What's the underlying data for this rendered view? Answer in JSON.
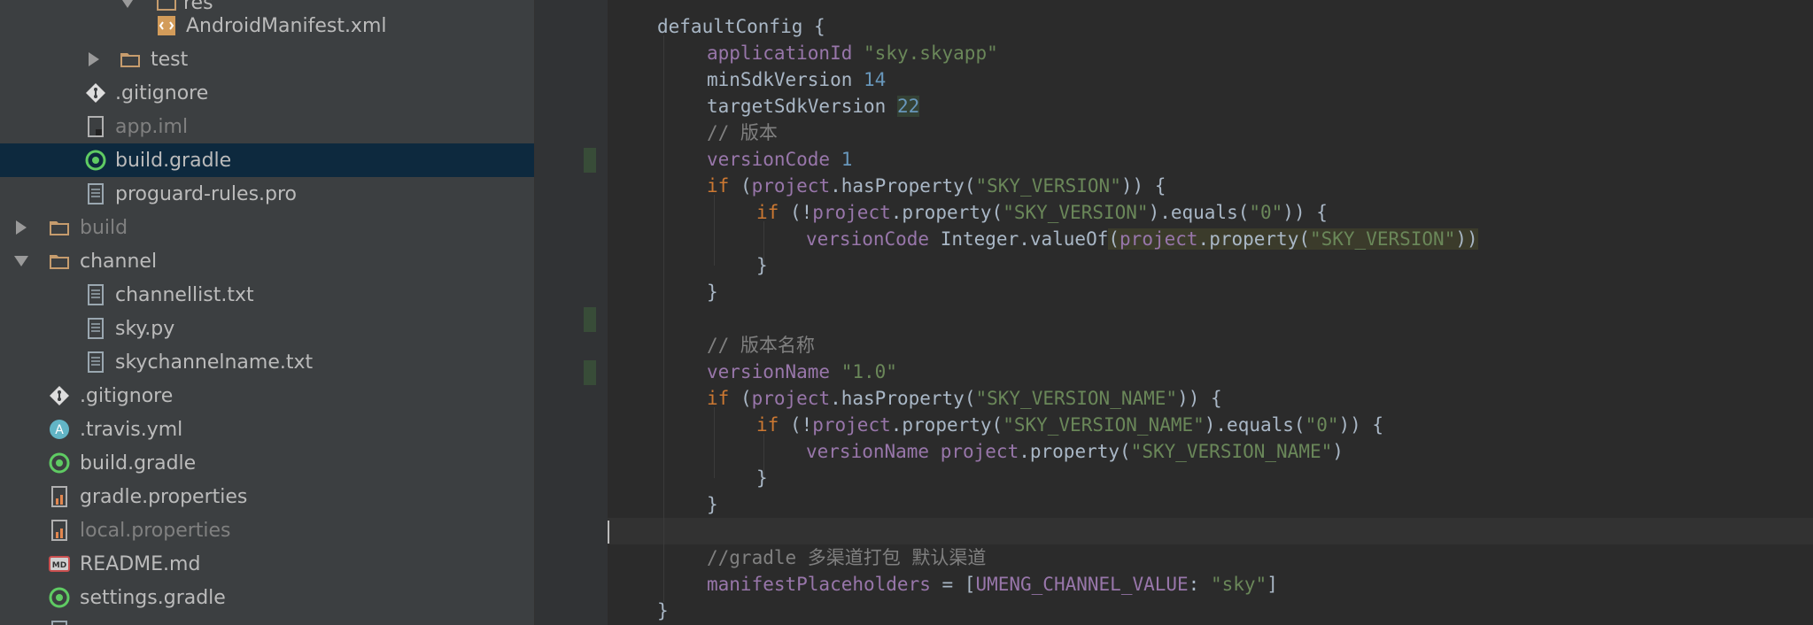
{
  "project_tree": {
    "items": [
      {
        "label": "res",
        "icon": "folder-icon",
        "arrow": "down"
      },
      {
        "label": "AndroidManifest.xml",
        "icon": "xml-file-icon"
      },
      {
        "label": "test",
        "icon": "folder-icon",
        "arrow": "right"
      },
      {
        "label": ".gitignore",
        "icon": "git-file-icon"
      },
      {
        "label": "app.iml",
        "icon": "iml-file-icon",
        "dim": true
      },
      {
        "label": "build.gradle",
        "icon": "gradle-icon",
        "selected": true
      },
      {
        "label": "proguard-rules.pro",
        "icon": "text-file-icon"
      },
      {
        "label": "build",
        "icon": "folder-icon",
        "arrow": "right",
        "dim": true
      },
      {
        "label": "channel",
        "icon": "folder-icon",
        "arrow": "down"
      },
      {
        "label": "channellist.txt",
        "icon": "text-file-icon"
      },
      {
        "label": "sky.py",
        "icon": "text-file-icon"
      },
      {
        "label": "skychannelname.txt",
        "icon": "text-file-icon"
      },
      {
        "label": ".gitignore",
        "icon": "git-file-icon"
      },
      {
        "label": ".travis.yml",
        "icon": "yml-file-icon"
      },
      {
        "label": "build.gradle",
        "icon": "gradle-icon"
      },
      {
        "label": "gradle.properties",
        "icon": "properties-file-icon"
      },
      {
        "label": "local.properties",
        "icon": "properties-file-icon",
        "dim": true
      },
      {
        "label": "README.md",
        "icon": "markdown-file-icon"
      },
      {
        "label": "settings.gradle",
        "icon": "gradle-icon"
      },
      {
        "label": "",
        "icon": "file-icon"
      }
    ]
  },
  "editor": {
    "lines": [
      [
        {
          "t": "defaultConfig {",
          "c": "p"
        }
      ],
      [
        {
          "t": "applicationId ",
          "c": "prop"
        },
        {
          "t": "\"sky.skyapp\"",
          "c": "str"
        }
      ],
      [
        {
          "t": "minSdkVersion ",
          "c": "p"
        },
        {
          "t": "14",
          "c": "num"
        }
      ],
      [
        {
          "t": "targetSdkVersion ",
          "c": "p"
        },
        {
          "t": "22",
          "c": "num hl2"
        }
      ],
      [
        {
          "t": "// 版本",
          "c": "cmt"
        }
      ],
      [
        {
          "t": "versionCode ",
          "c": "prop"
        },
        {
          "t": "1",
          "c": "num"
        }
      ],
      [
        {
          "t": "if ",
          "c": "kw"
        },
        {
          "t": "(",
          "c": "p"
        },
        {
          "t": "project",
          "c": "prop"
        },
        {
          "t": ".hasProperty(",
          "c": "p"
        },
        {
          "t": "\"SKY_VERSION\"",
          "c": "str"
        },
        {
          "t": ")) {",
          "c": "p"
        }
      ],
      [
        {
          "t": "if ",
          "c": "kw"
        },
        {
          "t": "(!",
          "c": "p"
        },
        {
          "t": "project",
          "c": "prop"
        },
        {
          "t": ".property(",
          "c": "p"
        },
        {
          "t": "\"SKY_VERSION\"",
          "c": "str"
        },
        {
          "t": ").equals(",
          "c": "p"
        },
        {
          "t": "\"0\"",
          "c": "str"
        },
        {
          "t": ")) {",
          "c": "p"
        }
      ],
      [
        {
          "t": "versionCode ",
          "c": "prop"
        },
        {
          "t": "Integer.valueOf",
          "c": "p"
        },
        {
          "t": "(",
          "c": "p hl"
        },
        {
          "t": "project",
          "c": "prop hl"
        },
        {
          "t": ".property(",
          "c": "p hl"
        },
        {
          "t": "\"SKY_VERSION\"",
          "c": "str hl"
        },
        {
          "t": "))",
          "c": "p hl"
        }
      ],
      [
        {
          "t": "}",
          "c": "p"
        }
      ],
      [
        {
          "t": "}",
          "c": "p"
        }
      ],
      [],
      [
        {
          "t": "// 版本名称",
          "c": "cmt"
        }
      ],
      [
        {
          "t": "versionName ",
          "c": "prop"
        },
        {
          "t": "\"1.0\"",
          "c": "str"
        }
      ],
      [
        {
          "t": "if ",
          "c": "kw"
        },
        {
          "t": "(",
          "c": "p"
        },
        {
          "t": "project",
          "c": "prop"
        },
        {
          "t": ".hasProperty(",
          "c": "p"
        },
        {
          "t": "\"SKY_VERSION_NAME\"",
          "c": "str"
        },
        {
          "t": ")) {",
          "c": "p"
        }
      ],
      [
        {
          "t": "if ",
          "c": "kw"
        },
        {
          "t": "(!",
          "c": "p"
        },
        {
          "t": "project",
          "c": "prop"
        },
        {
          "t": ".property(",
          "c": "p"
        },
        {
          "t": "\"SKY_VERSION_NAME\"",
          "c": "str"
        },
        {
          "t": ").equals(",
          "c": "p"
        },
        {
          "t": "\"0\"",
          "c": "str"
        },
        {
          "t": ")) {",
          "c": "p"
        }
      ],
      [
        {
          "t": "versionName ",
          "c": "prop"
        },
        {
          "t": "project",
          "c": "prop"
        },
        {
          "t": ".property(",
          "c": "p"
        },
        {
          "t": "\"SKY_VERSION_NAME\"",
          "c": "str"
        },
        {
          "t": ")",
          "c": "p"
        }
      ],
      [
        {
          "t": "}",
          "c": "p"
        }
      ],
      [
        {
          "t": "}",
          "c": "p"
        }
      ],
      [],
      [
        {
          "t": "//gradle 多渠道打包 默认渠道",
          "c": "cmt"
        }
      ],
      [
        {
          "t": "manifestPlaceholders ",
          "c": "prop"
        },
        {
          "t": "= [",
          "c": "p"
        },
        {
          "t": "UMENG_CHANNEL_VALUE",
          "c": "prop"
        },
        {
          "t": ": ",
          "c": "p"
        },
        {
          "t": "\"sky\"",
          "c": "str"
        },
        {
          "t": "]",
          "c": "p"
        }
      ],
      [
        {
          "t": "}",
          "c": "p"
        }
      ]
    ]
  },
  "colors": {
    "sidebar_bg": "#3c3f41",
    "editor_bg": "#2b2b2b",
    "selection": "#0d293e",
    "keyword": "#cc7832",
    "string": "#6a8759",
    "number": "#6897bb",
    "property": "#9876aa",
    "comment": "#808080"
  }
}
